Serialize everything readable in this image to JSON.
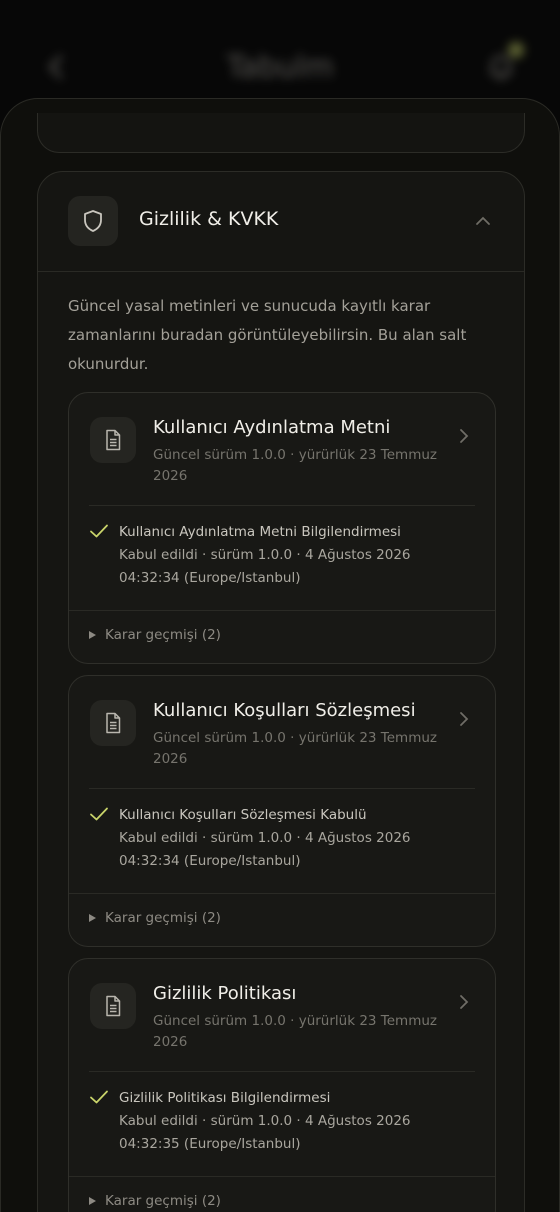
{
  "background": {
    "title": "Tabulm",
    "back_icon": "chevron-left-icon",
    "bell_icon": "bell-icon",
    "badge_color": "#c9d46a"
  },
  "section": {
    "title": "Gizlilik & KVKK",
    "icon": "shield-icon",
    "collapse_icon": "chevron-up-icon",
    "description": "Güncel yasal metinleri ve sunucuda kayıtlı karar zamanlarını buradan görüntüleyebilirsin. Bu alan salt okunurdur."
  },
  "documents": [
    {
      "title": "Kullanıcı Aydınlatma Metni",
      "meta": "Güncel sürüm 1.0.0 · yürürlük 23 Temmuz 2026",
      "consent_title": "Kullanıcı Aydınlatma Metni Bilgilendirmesi",
      "consent_detail": "Kabul edildi · sürüm 1.0.0 · 4 Ağustos 2026 04:32:34 (Europe/Istanbul)",
      "history": "Karar geçmişi (2)"
    },
    {
      "title": "Kullanıcı Koşulları Sözleşmesi",
      "meta": "Güncel sürüm 1.0.0 · yürürlük 23 Temmuz 2026",
      "consent_title": "Kullanıcı Koşulları Sözleşmesi Kabulü",
      "consent_detail": "Kabul edildi · sürüm 1.0.0 · 4 Ağustos 2026 04:32:34 (Europe/Istanbul)",
      "history": "Karar geçmişi (2)"
    },
    {
      "title": "Gizlilik Politikası",
      "meta": "Güncel sürüm 1.0.0 · yürürlük 23 Temmuz 2026",
      "consent_title": "Gizlilik Politikası Bilgilendirmesi",
      "consent_detail": "Kabul edildi · sürüm 1.0.0 · 4 Ağustos 2026 04:32:35 (Europe/Istanbul)",
      "history": "Karar geçmişi (2)"
    }
  ],
  "colors": {
    "accent_check": "#c9d46a",
    "surface": "#151512",
    "border": "#2c2c27"
  }
}
